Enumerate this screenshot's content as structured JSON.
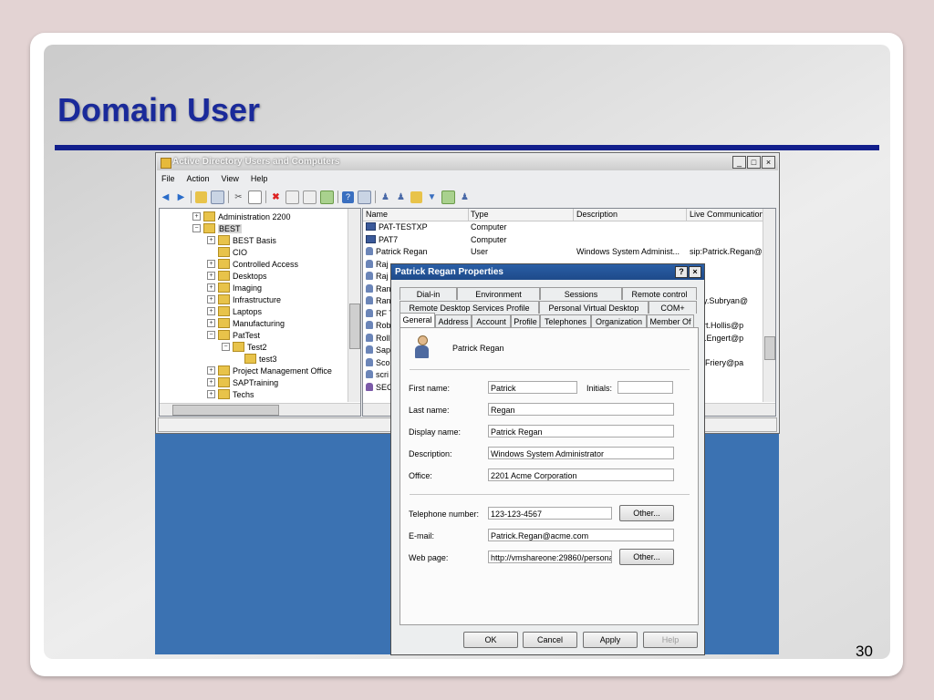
{
  "slide": {
    "title": "Domain User",
    "page_number": "30"
  },
  "ad_window": {
    "title": "Active Directory Users and Computers",
    "menu": [
      "File",
      "Action",
      "View",
      "Help"
    ],
    "tree": [
      {
        "label": "Administration 2200",
        "expander": "+",
        "indent": 0
      },
      {
        "label": "BEST",
        "expander": "−",
        "indent": 0,
        "selected": true
      },
      {
        "label": "BEST Basis",
        "expander": "+",
        "indent": 1
      },
      {
        "label": "CIO",
        "expander": "",
        "indent": 1
      },
      {
        "label": "Controlled Access",
        "expander": "+",
        "indent": 1
      },
      {
        "label": "Desktops",
        "expander": "+",
        "indent": 1
      },
      {
        "label": "Imaging",
        "expander": "+",
        "indent": 1
      },
      {
        "label": "Infrastructure",
        "expander": "+",
        "indent": 1
      },
      {
        "label": "Laptops",
        "expander": "+",
        "indent": 1
      },
      {
        "label": "Manufacturing",
        "expander": "+",
        "indent": 1
      },
      {
        "label": "PatTest",
        "expander": "−",
        "indent": 1
      },
      {
        "label": "Test2",
        "expander": "−",
        "indent": 2
      },
      {
        "label": "test3",
        "expander": "",
        "indent": 3
      },
      {
        "label": "Project Management Office",
        "expander": "+",
        "indent": 1
      },
      {
        "label": "SAPTraining",
        "expander": "+",
        "indent": 1
      },
      {
        "label": "Techs",
        "expander": "+",
        "indent": 1
      }
    ],
    "list_columns": [
      "Name",
      "Type",
      "Description",
      "Live Communications"
    ],
    "list_rows": [
      {
        "name": "PAT-TESTXP",
        "type": "Computer",
        "description": "",
        "live": "",
        "icon": "computer"
      },
      {
        "name": "PAT7",
        "type": "Computer",
        "description": "",
        "live": "",
        "icon": "computer"
      },
      {
        "name": "Patrick Regan",
        "type": "User",
        "description": "Windows System Administ...",
        "live": "sip:Patrick.Regan@p",
        "icon": "user"
      },
      {
        "name": "Raj",
        "type": "",
        "description": "",
        "live": "",
        "icon": "user"
      },
      {
        "name": "Raj",
        "type": "",
        "description": "",
        "live": "",
        "icon": "user"
      },
      {
        "name": "Ran",
        "type": "",
        "description": "",
        "live": "",
        "icon": "user"
      },
      {
        "name": "Ran",
        "type": "",
        "description": "",
        "live": "andy.Subryan@",
        "icon": "user"
      },
      {
        "name": "RF T",
        "type": "",
        "description": "",
        "live": "",
        "icon": "user"
      },
      {
        "name": "Rob",
        "type": "",
        "description": "",
        "live": "obert.Hollis@p",
        "icon": "user"
      },
      {
        "name": "Roll",
        "type": "",
        "description": "",
        "live": "ollin.Engert@p",
        "icon": "user"
      },
      {
        "name": "Sap",
        "type": "",
        "description": "",
        "live": "",
        "icon": "user"
      },
      {
        "name": "Sco",
        "type": "",
        "description": "",
        "live": "cott.Friery@pa",
        "icon": "user"
      },
      {
        "name": "scri",
        "type": "",
        "description": "",
        "live": "",
        "icon": "user"
      },
      {
        "name": "SEC",
        "type": "",
        "description": "",
        "live": "",
        "icon": "group"
      }
    ]
  },
  "dialog": {
    "title": "Patrick Regan Properties",
    "help_btn": "?",
    "close_btn": "×",
    "tabs_row1": [
      "Dial-in",
      "Environment",
      "Sessions",
      "Remote control"
    ],
    "tabs_row2": [
      "Remote Desktop Services Profile",
      "Personal Virtual Desktop",
      "COM+"
    ],
    "tabs_row3": [
      "General",
      "Address",
      "Account",
      "Profile",
      "Telephones",
      "Organization",
      "Member Of"
    ],
    "display_name": "Patrick Regan",
    "fields": {
      "first_name_label": "First name:",
      "first_name": "Patrick",
      "initials_label": "Initials:",
      "initials": "",
      "last_name_label": "Last name:",
      "last_name": "Regan",
      "display_name_label": "Display name:",
      "display_name": "Patrick Regan",
      "description_label": "Description:",
      "description": "Windows System Administrator",
      "office_label": "Office:",
      "office": "2201 Acme Corporation",
      "telephone_label": "Telephone number:",
      "telephone": "123-123-4567",
      "email_label": "E-mail:",
      "email": "Patrick.Regan@acme.com",
      "webpage_label": "Web page:",
      "webpage": "http://vmshareone:29860/persona"
    },
    "other_btn": "Other...",
    "buttons": {
      "ok": "OK",
      "cancel": "Cancel",
      "apply": "Apply",
      "help": "Help"
    }
  },
  "colors": {
    "title": "#1a2a9a",
    "rule": "#121f8c",
    "desktop": "#3b72b2",
    "dialog_title": "#1e4a8a"
  }
}
